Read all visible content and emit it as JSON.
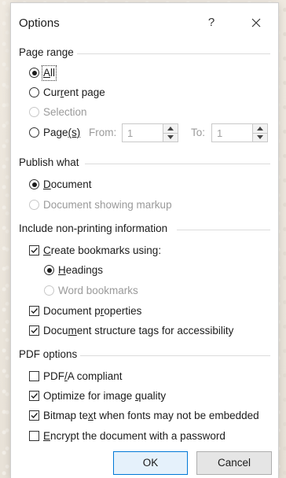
{
  "dialog": {
    "title": "Options",
    "help_label": "?",
    "close_icon": "close-icon"
  },
  "page_range": {
    "heading": "Page range",
    "all": {
      "pre": "",
      "accel": "A",
      "post": "ll",
      "selected": true
    },
    "current_page": {
      "pre": "Cur",
      "accel": "r",
      "post": "ent page",
      "selected": false
    },
    "selection": {
      "label": "Selection",
      "enabled": false
    },
    "pages": {
      "pre": "Page",
      "accel": "(s)",
      "post": "",
      "selected": false
    },
    "from_label": "From:",
    "from_value": "1",
    "to_label": "To:",
    "to_value": "1"
  },
  "publish_what": {
    "heading": "Publish what",
    "document": {
      "pre": "",
      "accel": "D",
      "post": "ocument",
      "selected": true
    },
    "document_markup": {
      "label": "Document showing markup",
      "enabled": false
    }
  },
  "non_printing": {
    "heading": "Include non-printing information",
    "create_bookmarks": {
      "pre": "",
      "accel": "C",
      "post": "reate bookmarks using:",
      "checked": true
    },
    "headings": {
      "pre": "",
      "accel": "H",
      "post": "eadings",
      "selected": true
    },
    "word_bookmarks": {
      "label": "Word bookmarks",
      "enabled": false
    },
    "doc_properties": {
      "pre": "Document p",
      "accel": "r",
      "post": "operties",
      "checked": true
    },
    "structure_tags": {
      "pre": "Docu",
      "accel": "m",
      "post": "ent structure tags for accessibility",
      "checked": true
    }
  },
  "pdf_options": {
    "heading": "PDF options",
    "pdfa": {
      "pre": "PDF",
      "accel": "/",
      "post": "A compliant",
      "checked": false
    },
    "optimize": {
      "pre": "Optimize for image ",
      "accel": "q",
      "post": "uality",
      "checked": true
    },
    "bitmap": {
      "pre": "Bitmap te",
      "accel": "x",
      "post": "t when fonts may not be embedded",
      "checked": true
    },
    "encrypt": {
      "pre": "",
      "accel": "E",
      "post": "ncrypt the document with a password",
      "checked": false
    }
  },
  "buttons": {
    "ok": "OK",
    "cancel": "Cancel"
  }
}
